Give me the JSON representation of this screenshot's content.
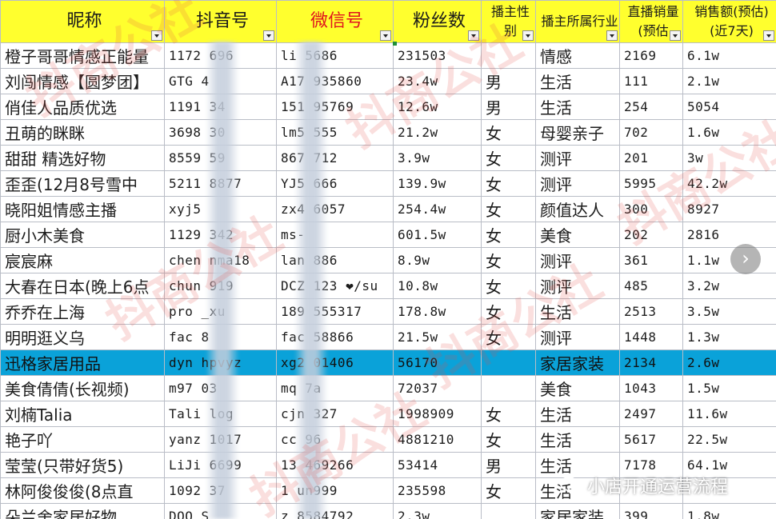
{
  "headers": [
    {
      "label": "昵称",
      "style": "normal"
    },
    {
      "label": "抖音号",
      "style": "normal"
    },
    {
      "label": "微信号",
      "style": "red"
    },
    {
      "label": "粉丝数",
      "style": "normal"
    },
    {
      "label": "播主性别",
      "style": "small"
    },
    {
      "label": "播主所属行业",
      "style": "small"
    },
    {
      "label": "直播销量(预估",
      "style": "small"
    },
    {
      "label": "销售额(预估)(近7天)",
      "style": "small"
    }
  ],
  "rows": [
    [
      "橙子哥哥情感正能量",
      "1172    696",
      "li    5686",
      "231503",
      "",
      "情感",
      "2169",
      "6.1w"
    ],
    [
      "刘闯情感【圆梦团】",
      "GTG    4",
      "A17    935860",
      "23.4w",
      "男",
      "生活",
      "111",
      "2.1w"
    ],
    [
      "俏佳人品质优选",
      "1191    34",
      "151    95769",
      "12.6w",
      "男",
      "生活",
      "254",
      "5054"
    ],
    [
      "丑萌的眯眯",
      "3698    30",
      "lm5    555",
      "21.2w",
      "女",
      "母婴亲子",
      "702",
      "1.6w"
    ],
    [
      "甜甜  精选好物",
      "8559    59",
      "867    712",
      "3.9w",
      "女",
      "测评",
      "201",
      "3w"
    ],
    [
      "歪歪(12月8号雪中",
      "5211    8877",
      "YJ5    666",
      "139.9w",
      "女",
      "测评",
      "5995",
      "42.2w"
    ],
    [
      "晓阳姐情感主播",
      "xyj5",
      "zx4    6057",
      "254.4w",
      "女",
      "颜值达人",
      "300",
      "8927"
    ],
    [
      "厨小木美食",
      "1129    342",
      "ms-",
      "601.5w",
      "女",
      "美食",
      "202",
      "2816"
    ],
    [
      "宸宸麻",
      "chen    nma18",
      "lan    886",
      "8.9w",
      "女",
      "测评",
      "361",
      "1.1w"
    ],
    [
      "大春在日本(晚上6点",
      "chun    919",
      "DCZ    123 ❤/su",
      "10.8w",
      "女",
      "测评",
      "485",
      "3.2w"
    ],
    [
      "乔乔在上海",
      "pro    _xu",
      "189    555317",
      "178.8w",
      "女",
      "生活",
      "2513",
      "3.5w"
    ],
    [
      "明明逛义乌",
      "fac    8",
      "fac    58866",
      "21.5w",
      "女",
      "测评",
      "1448",
      "1.3w"
    ],
    [
      "迅格家居用品",
      "dyn    hpvyz",
      "xg2    01406",
      "56170",
      "",
      "家居家装",
      "2134",
      "2.6w"
    ],
    [
      "美食倩倩(长视频)",
      "m97    03",
      "mq    7a",
      "72037",
      "",
      "美食",
      "1043",
      "1.5w"
    ],
    [
      "刘楠Talia",
      "Tali    log",
      "cjn    327",
      "1998909",
      "女",
      "生活",
      "2497",
      "11.6w"
    ],
    [
      "艳子吖",
      "yanz    1017",
      "cc    96",
      "4881210",
      "女",
      "生活",
      "5617",
      "22.5w"
    ],
    [
      "莹莹(只带好货5)",
      "LiJi    6699",
      "13    469266",
      "53414",
      "男",
      "生活",
      "7178",
      "64.1w"
    ],
    [
      "林阿俊俊俊(8点直",
      "1092    37",
      "1    un999",
      "235598",
      "女",
      "生活",
      "",
      ""
    ],
    [
      "朵兰舍家居好物",
      "DOO    S",
      "z    8584792",
      "2.3w",
      "",
      "家居家装",
      "399",
      "1.8w"
    ]
  ],
  "selected_row_index": 12,
  "overlay": {
    "next_icon": "chevron-right-icon",
    "next_glyph": "›",
    "wechat_icon": "wechat-icon",
    "wechat_label": "小店开通运营流程"
  },
  "colors": {
    "header_bg": "#ffff2e",
    "selected_row_bg": "#0aa2d9",
    "red_header_text": "#e0141e"
  }
}
